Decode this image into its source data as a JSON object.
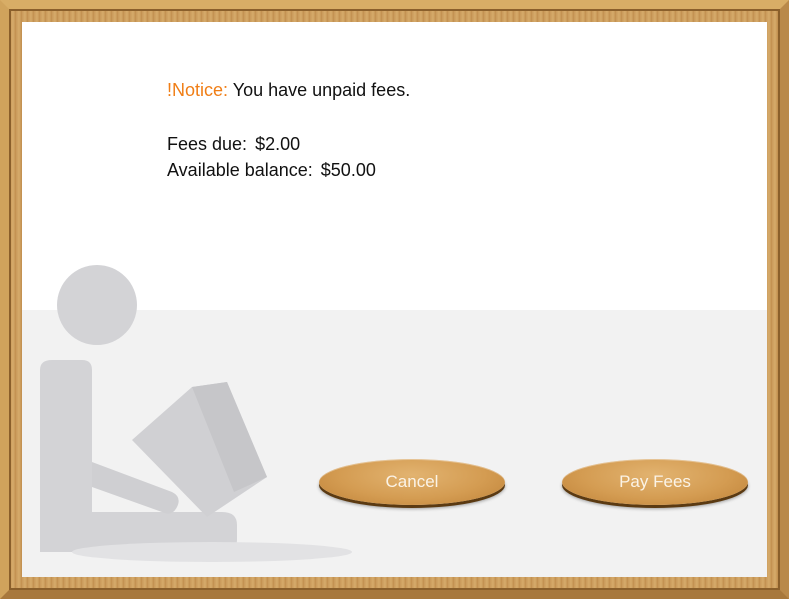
{
  "notice": {
    "tag": "!Notice:",
    "message": "You have unpaid fees."
  },
  "fees": {
    "due_label": "Fees due:",
    "due_value": "$2.00",
    "balance_label": "Available balance:",
    "balance_value": "$50.00"
  },
  "buttons": {
    "cancel": "Cancel",
    "pay": "Pay Fees"
  },
  "colors": {
    "notice_accent": "#f07e16",
    "button_fill": "#d49c52",
    "frame_wood": "#c89a55"
  }
}
